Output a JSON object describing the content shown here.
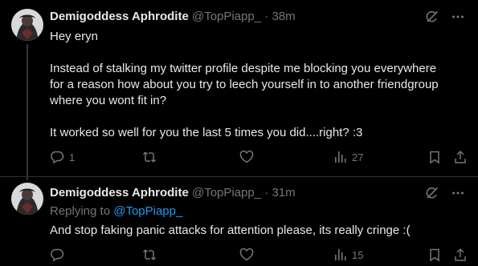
{
  "colors": {
    "background": "#000000",
    "text": "#e7e9ea",
    "muted": "#71767b",
    "link": "#1d9bf0",
    "divider": "#2f3336"
  },
  "tweets": [
    {
      "display_name": "Demigoddess Aphrodite",
      "handle": "@TopPiapp_",
      "separator": "·",
      "time": "38m",
      "lines": [
        "Hey eryn",
        "Instead of stalking my twitter profile despite me blocking you everywhere for a reason how about you try to leech yourself in to another friendgroup where you wont fit in?",
        "It worked so well for you the last 5 times you did....right? :3"
      ],
      "reply_count": "1",
      "retweet_count": "",
      "like_count": "",
      "views_count": "27"
    },
    {
      "display_name": "Demigoddess Aphrodite",
      "handle": "@TopPiapp_",
      "separator": "·",
      "time": "31m",
      "replying_to_label": "Replying to",
      "replying_to_handle": "@TopPiapp_",
      "text": "And stop faking panic attacks for attention please, its really cringe :(",
      "reply_count": "",
      "retweet_count": "",
      "like_count": "",
      "views_count": "15"
    }
  ],
  "icons": {
    "top_right": [
      "grok-icon",
      "more-icon"
    ],
    "actions": [
      "reply-icon",
      "retweet-icon",
      "like-icon",
      "views-icon",
      "bookmark-icon",
      "share-icon"
    ]
  }
}
